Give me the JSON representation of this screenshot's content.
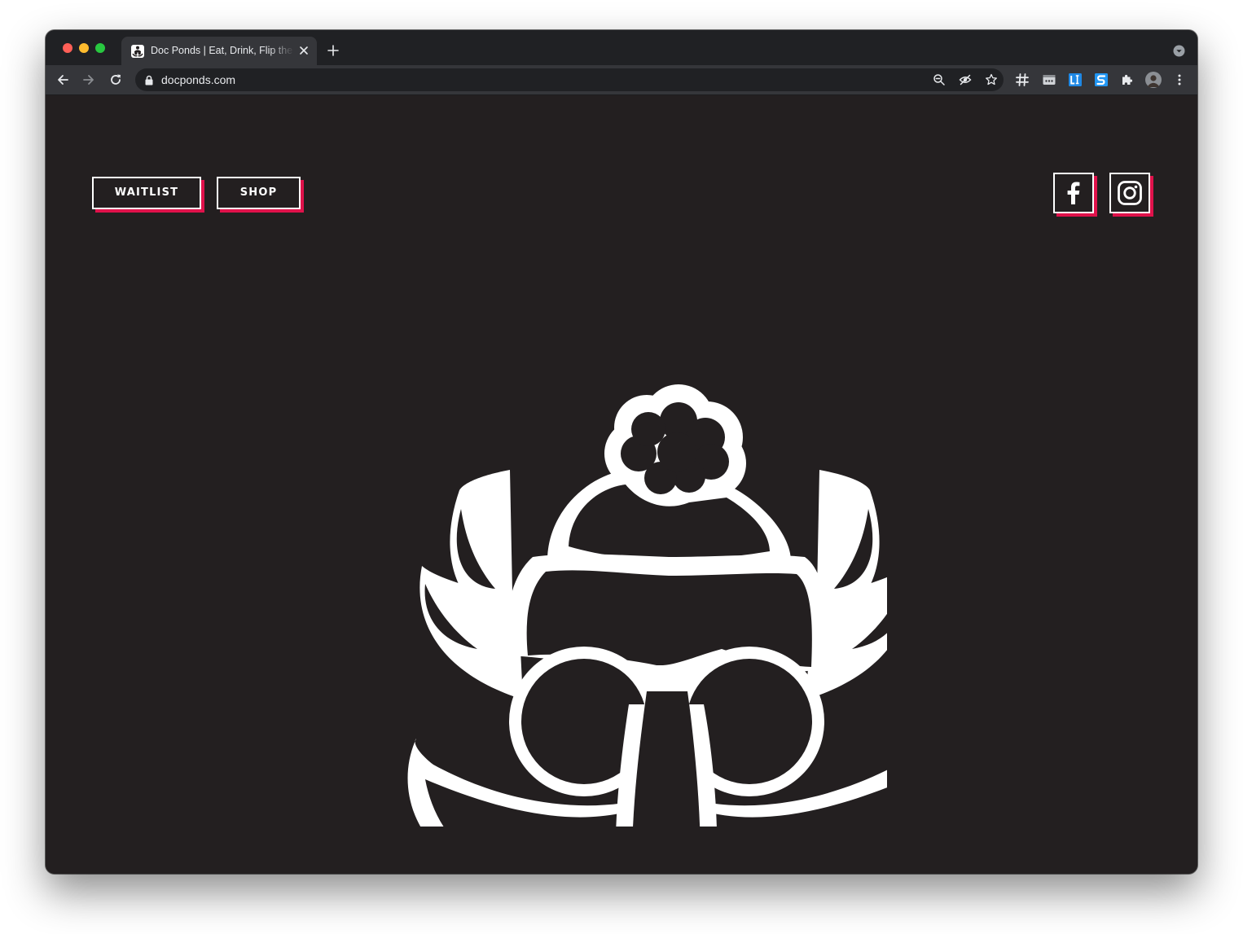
{
  "browser": {
    "tab_title": "Doc Ponds | Eat, Drink, Flip the Pond",
    "url": "docponds.com",
    "toolbar_icons": [
      "back-icon",
      "forward-icon",
      "reload-icon",
      "zoom-icon",
      "tracking-blocked-icon",
      "bookmark-star-icon",
      "hashtag-extension-icon",
      "dots-extension-icon",
      "li-extension-icon",
      "s-extension-icon",
      "extensions-puzzle-icon",
      "profile-avatar",
      "menu-kebab-icon"
    ]
  },
  "site": {
    "nav": {
      "waitlist_label": "WAITLIST",
      "shop_label": "SHOP"
    },
    "social": [
      "facebook-icon",
      "instagram-icon"
    ],
    "logo": "doc-ponds-mascot-logo",
    "colors": {
      "background": "#231f20",
      "foreground": "#ffffff",
      "accent": "#e0124b"
    }
  }
}
